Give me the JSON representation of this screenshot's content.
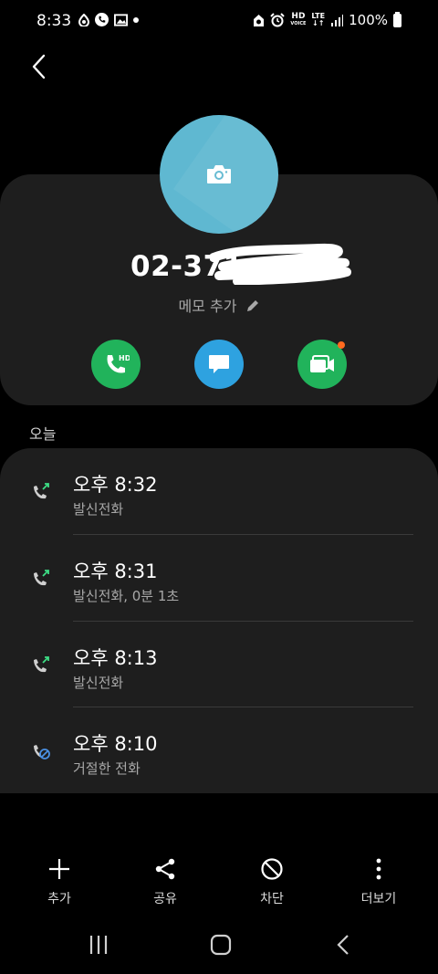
{
  "status_bar": {
    "time": "8:33",
    "hd_label": "HD",
    "hd_sub": "VOICE",
    "lte_label": "LTE",
    "battery": "100%"
  },
  "contact": {
    "phone_number": "02-371",
    "memo_label": "메모 추가"
  },
  "actions": {
    "call_badge": "HD"
  },
  "section": {
    "today": "오늘"
  },
  "call_log": [
    {
      "time": "오후 8:32",
      "type": "발신전화",
      "kind": "outgoing"
    },
    {
      "time": "오후 8:31",
      "type": "발신전화, 0분 1초",
      "kind": "outgoing"
    },
    {
      "time": "오후 8:13",
      "type": "발신전화",
      "kind": "outgoing"
    },
    {
      "time": "오후 8:10",
      "type": "거절한 전화",
      "kind": "rejected"
    }
  ],
  "toolbar": {
    "add_label": "추가",
    "share_label": "공유",
    "block_label": "차단",
    "more_label": "더보기"
  },
  "colors": {
    "avatar": "#5fb8d1",
    "call_green": "#21b35b",
    "message_blue": "#2ea2e0",
    "notification_orange": "#ff6a1f",
    "outgoing_arrow": "#3ddc84",
    "rejected_icon": "#4a90e2"
  },
  "icons": {
    "back": "chevron-left-icon",
    "camera": "camera-icon",
    "edit": "pencil-icon",
    "call": "phone-hd-icon",
    "message": "message-icon",
    "video": "video-call-icon",
    "outgoing": "outgoing-call-icon",
    "rejected": "rejected-call-icon",
    "add": "plus-icon",
    "share": "share-icon",
    "block": "block-icon",
    "more": "more-vertical-icon"
  }
}
